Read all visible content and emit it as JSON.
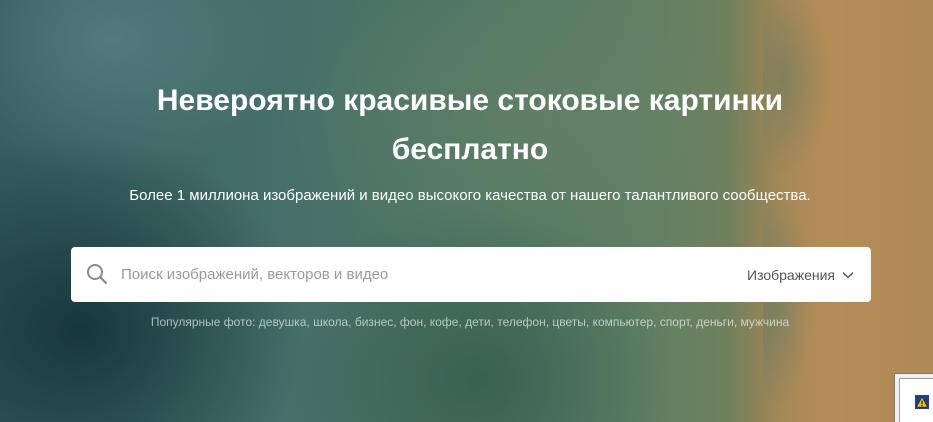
{
  "hero": {
    "title_line1": "Невероятно красивые стоковые картинки",
    "title_line2": "бесплатно",
    "subtitle": "Более 1 миллиона изображений и видео высокого качества от нашего талантливого сообщества."
  },
  "search": {
    "placeholder": "Поиск изображений, векторов и видео",
    "value": "",
    "type_selected": "Изображения"
  },
  "popular": {
    "label": "Популярные фото:",
    "tags": [
      "девушка",
      "школа",
      "бизнес",
      "фон",
      "кофе",
      "дети",
      "телефон",
      "цветы",
      "компьютер",
      "спорт",
      "деньги",
      "мужчина"
    ]
  },
  "colors": {
    "water": "#4f7f78",
    "sand": "#c99f63",
    "text": "#ffffff"
  },
  "icons": {
    "search": "search-icon",
    "dropdown": "chevron-down-icon",
    "corner": "warning-icon"
  }
}
